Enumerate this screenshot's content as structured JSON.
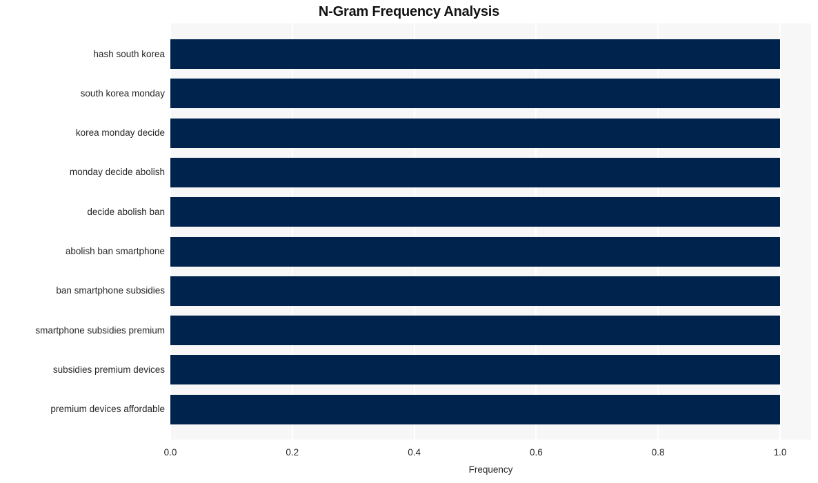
{
  "chart_data": {
    "type": "bar",
    "orientation": "horizontal",
    "title": "N-Gram Frequency Analysis",
    "xlabel": "Frequency",
    "ylabel": "",
    "categories": [
      "hash south korea",
      "south korea monday",
      "korea monday decide",
      "monday decide abolish",
      "decide abolish ban",
      "abolish ban smartphone",
      "ban smartphone subsidies",
      "smartphone subsidies premium",
      "subsidies premium devices",
      "premium devices affordable"
    ],
    "values": [
      1.0,
      1.0,
      1.0,
      1.0,
      1.0,
      1.0,
      1.0,
      1.0,
      1.0,
      1.0
    ],
    "xlim": [
      0.0,
      1.0
    ],
    "xticks": [
      "0.0",
      "0.2",
      "0.4",
      "0.6",
      "0.8",
      "1.0"
    ],
    "xtick_values": [
      0.0,
      0.2,
      0.4,
      0.6,
      0.8,
      1.0
    ],
    "grid": true,
    "grid_axis": "x",
    "legend": false,
    "bar_color": "#00234d",
    "plot_background": "#f7f7f7",
    "grid_color": "#ffffff",
    "figure_background": "#ffffff",
    "text_color": "#262626"
  }
}
